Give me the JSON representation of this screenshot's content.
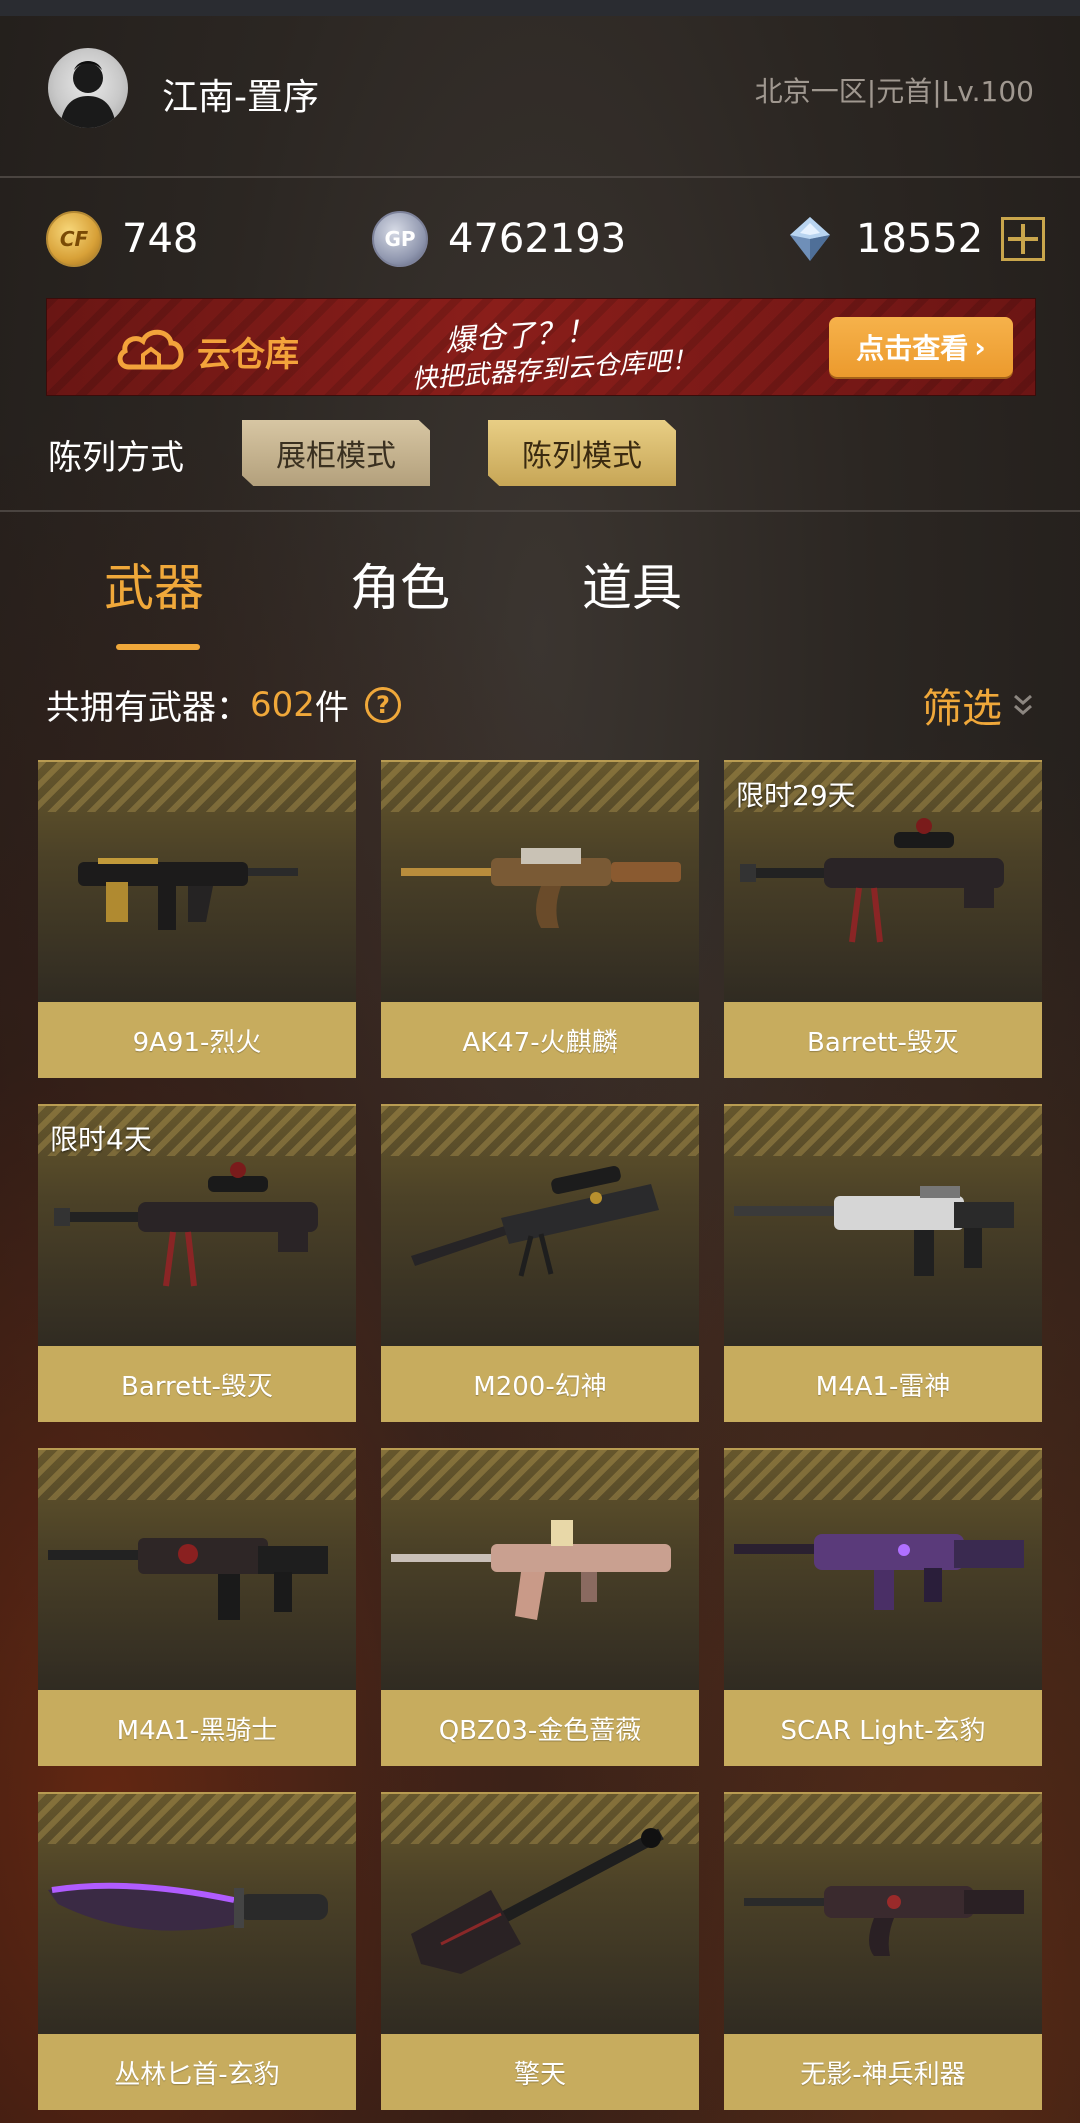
{
  "profile": {
    "username": "江南-置序",
    "server_info": "北京一区|元首|Lv.100"
  },
  "currency": {
    "cf_points": "748",
    "gp_points": "4762193",
    "diamonds": "18552",
    "cf_icon": "CF",
    "gp_icon": "GP"
  },
  "banner": {
    "name": "云仓库",
    "slogan_line1": "爆仓了？！",
    "slogan_line2": "快把武器存到云仓库吧！",
    "button_label": "点击查看"
  },
  "display_mode": {
    "label": "陈列方式",
    "options": [
      "展柜模式",
      "陈列模式"
    ],
    "selected": "陈列模式"
  },
  "tabs": [
    {
      "label": "武器",
      "active": true
    },
    {
      "label": "角色",
      "active": false
    },
    {
      "label": "道具",
      "active": false
    }
  ],
  "inventory": {
    "count_prefix": "共拥有武器：",
    "count": "602",
    "count_suffix": "件",
    "help": "?",
    "filter_label": "筛选"
  },
  "weapons": [
    {
      "name": "9A91-烈火",
      "tag": ""
    },
    {
      "name": "AK47-火麒麟",
      "tag": ""
    },
    {
      "name": "Barrett-毁灭",
      "tag": "限时29天"
    },
    {
      "name": "Barrett-毁灭",
      "tag": "限时4天"
    },
    {
      "name": "M200-幻神",
      "tag": ""
    },
    {
      "name": "M4A1-雷神",
      "tag": ""
    },
    {
      "name": "M4A1-黑骑士",
      "tag": ""
    },
    {
      "name": "QBZ03-金色蔷薇",
      "tag": ""
    },
    {
      "name": "SCAR Light-玄豹",
      "tag": ""
    },
    {
      "name": "丛林匕首-玄豹",
      "tag": ""
    },
    {
      "name": "擎天",
      "tag": ""
    },
    {
      "name": "无影-神兵利器",
      "tag": ""
    }
  ],
  "colors": {
    "accent": "#f0a83a",
    "card_label": "#c7ac5e",
    "background": "#2b2622"
  }
}
